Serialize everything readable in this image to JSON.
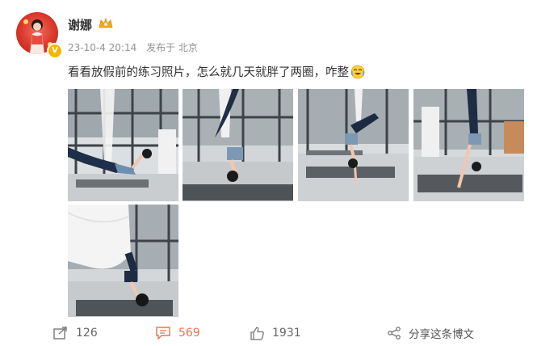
{
  "user": {
    "name": "谢娜"
  },
  "post": {
    "date": "23-10-4 20:14",
    "source": "发布于 北京",
    "text": "看看放假前的练习照片，怎么就几天就胖了两圈，咋整"
  },
  "actions": {
    "repost_count": "126",
    "comment_count": "569",
    "like_count": "1931",
    "share_label": "分享这条博文"
  },
  "colors": {
    "comment_accent": "#eb7350",
    "verified": "#f7b500"
  },
  "icons": {
    "repost": "repost-icon",
    "comment": "comment-icon",
    "like": "thumbs-up-icon",
    "share": "share-icon"
  }
}
